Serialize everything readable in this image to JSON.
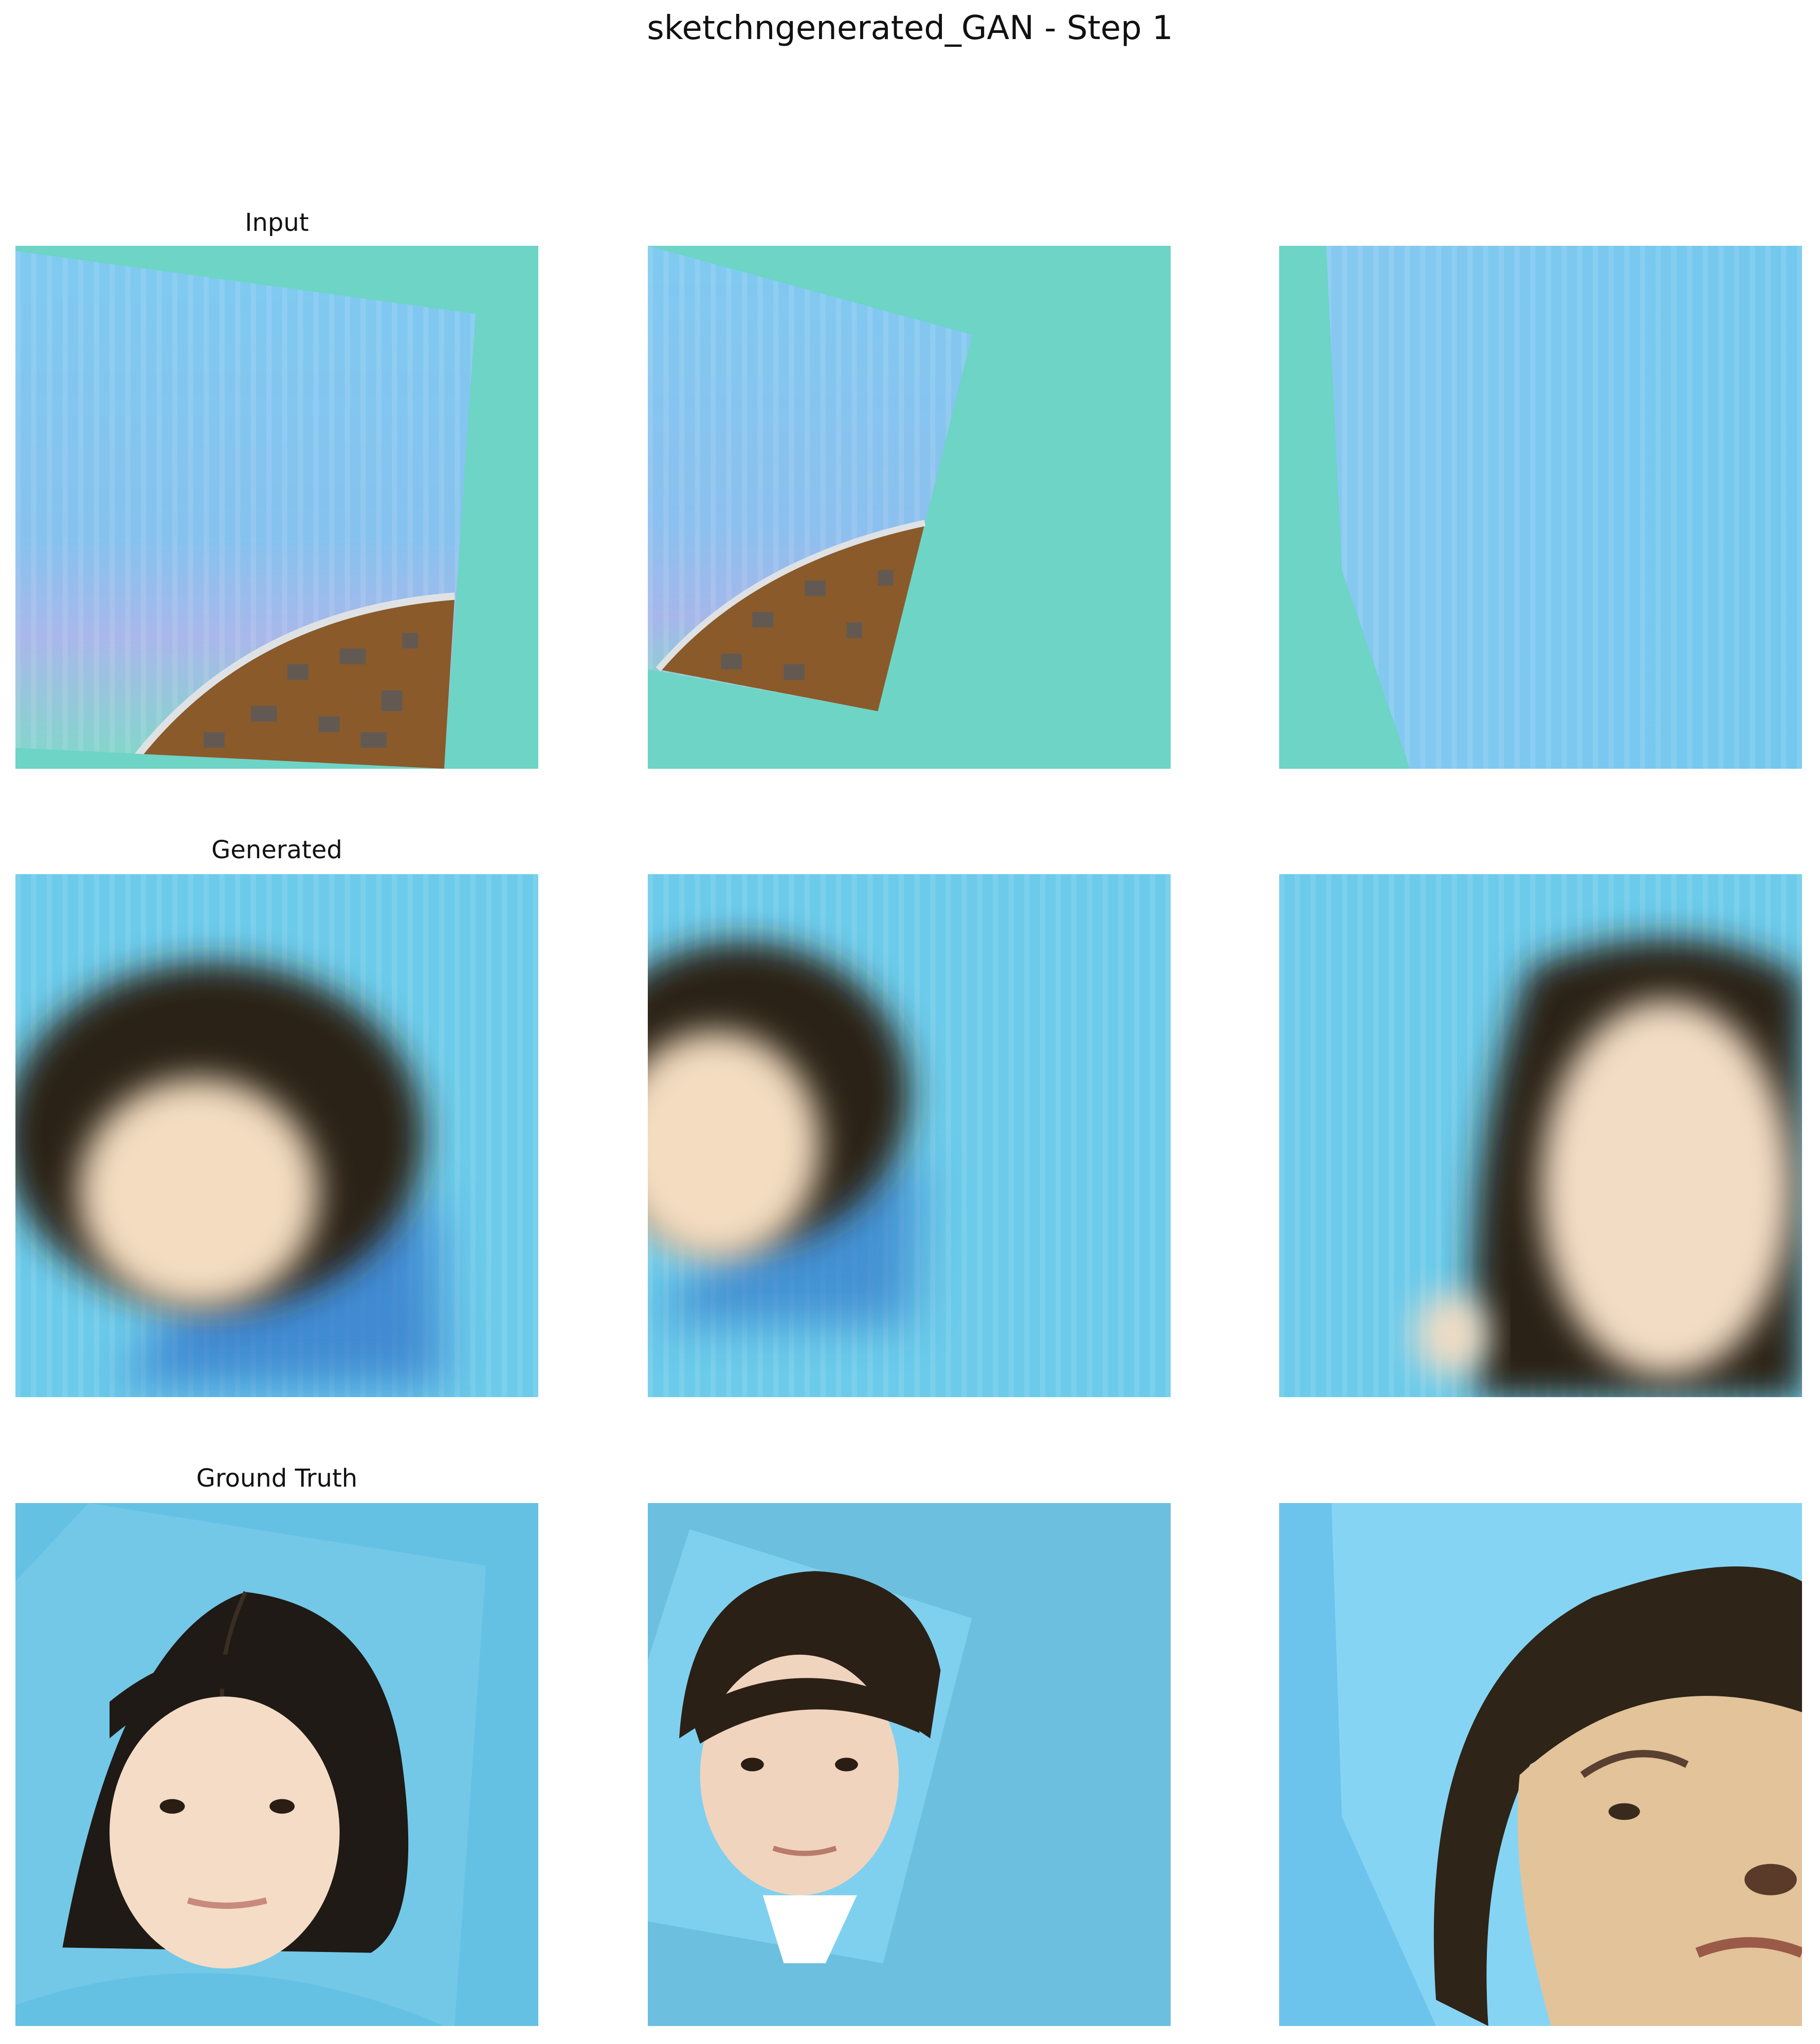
{
  "figure": {
    "title": "sketchngenerated_GAN - Step 1"
  },
  "rows": [
    {
      "label": "Input",
      "panels": [
        {
          "description": "rotated sketch with blue streaked upper area and brown textured quarter-circle, teal background"
        },
        {
          "description": "smaller rotated sketch with brown textured arc, teal background"
        },
        {
          "description": "blue streaked sheet covering most of the frame over teal background"
        }
      ]
    },
    {
      "label": "Generated",
      "panels": [
        {
          "description": "blurry blue image with dark hair blob and pale face blob"
        },
        {
          "description": "blurry blue image with small dark hair blob on the left"
        },
        {
          "description": "blurry blue image with large dark hair and pale face on the right"
        }
      ]
    },
    {
      "label": "Ground Truth",
      "panels": [
        {
          "description": "woman with short dark bob hair on blue background"
        },
        {
          "description": "young man with dark hair in a rotated frame on blue background"
        },
        {
          "description": "close-up of an older man's face on blue background"
        }
      ]
    }
  ],
  "colors": {
    "teal": "#6dd4c6",
    "sky": "#6ccbea",
    "truth_blue": "#64c1e4",
    "hair": "#2a2118",
    "skin": "#f3dcc0",
    "earth": "#8a5a2a"
  }
}
